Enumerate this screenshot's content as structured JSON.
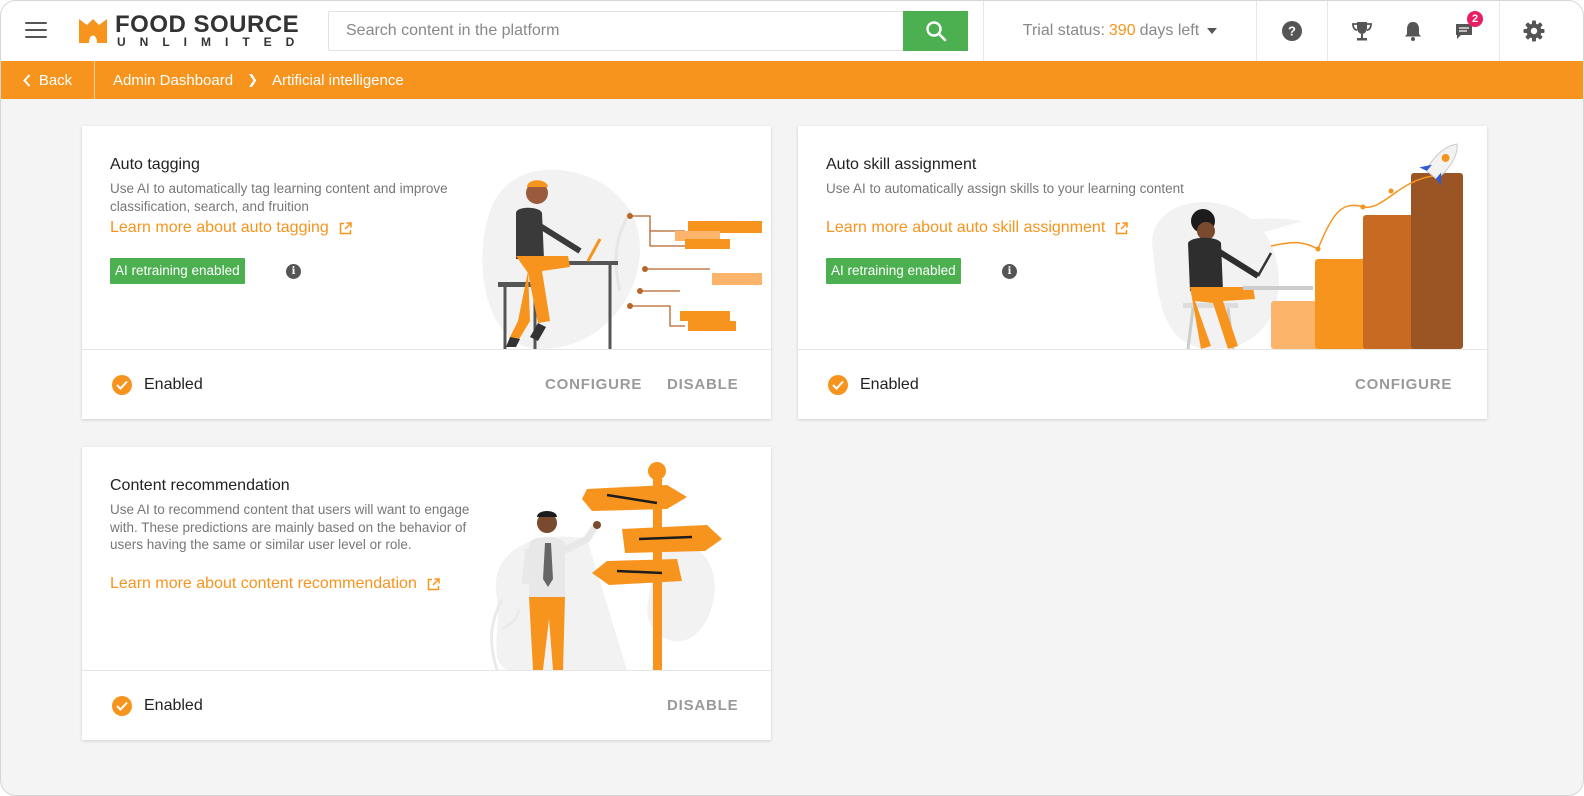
{
  "header": {
    "logo_line1": "FOOD SOURCE",
    "logo_line2": "UNLIMITED",
    "search_placeholder": "Search content in the platform",
    "trial_prefix": "Trial status:",
    "trial_days": "390",
    "trial_suffix": "days left",
    "messages_badge": "2"
  },
  "breadcrumb": {
    "back_label": "Back",
    "items": [
      "Admin Dashboard",
      "Artificial intelligence"
    ]
  },
  "cards": [
    {
      "title": "Auto tagging",
      "description": "Use AI to automatically tag learning content and improve classification, search, and fruition",
      "learn_more": "Learn more about auto tagging",
      "tag": "AI retraining enabled",
      "status": "Enabled",
      "actions": [
        "CONFIGURE",
        "DISABLE"
      ]
    },
    {
      "title": "Auto skill assignment",
      "description": "Use AI to automatically assign skills to your learning content",
      "learn_more": "Learn more about auto skill assignment",
      "tag": "AI retraining enabled",
      "status": "Enabled",
      "actions": [
        "CONFIGURE"
      ]
    },
    {
      "title": "Content recommendation",
      "description": "Use AI to recommend content that users will want to engage with. These predictions are mainly based on the behavior of users having the same or similar user level or role.",
      "learn_more": "Learn more about content recommendation",
      "status": "Enabled",
      "actions": [
        "DISABLE"
      ]
    }
  ],
  "colors": {
    "accent": "#f7941d",
    "success": "#4caf50",
    "badge": "#e91e63"
  }
}
